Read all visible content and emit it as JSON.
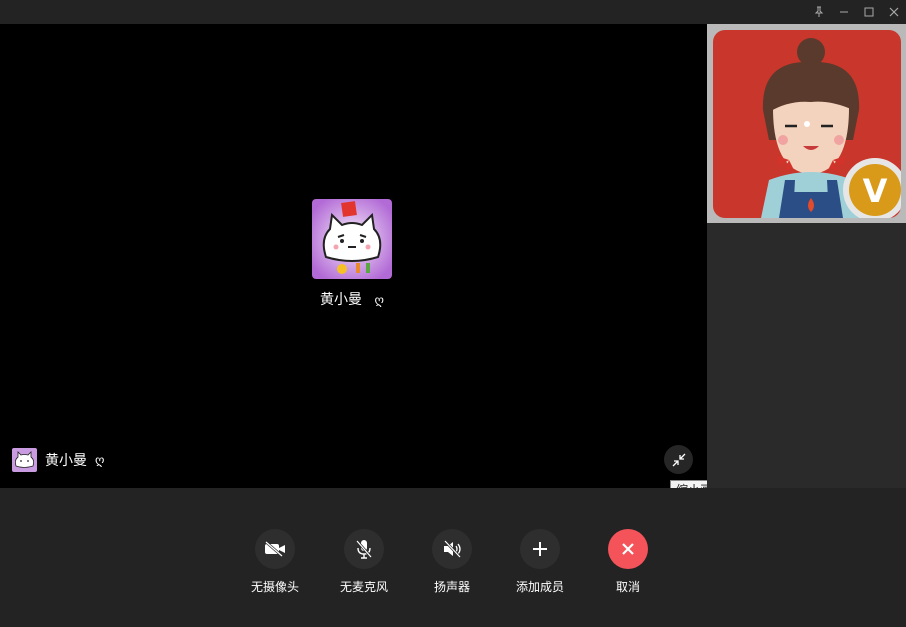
{
  "window": {
    "buttons": [
      "pin-icon",
      "minimize-icon",
      "maximize-icon",
      "close-icon"
    ]
  },
  "call": {
    "caller_name": "黄小曼",
    "corner_name": "黄小曼",
    "status_glyph": "ღ",
    "shrink_tooltip": "缩小画面"
  },
  "side": {
    "badge_letter": "V"
  },
  "controls": [
    {
      "id": "camera",
      "label": "无摄像头",
      "icon": "camera-off-icon"
    },
    {
      "id": "mic",
      "label": "无麦克风",
      "icon": "mic-off-icon"
    },
    {
      "id": "speaker",
      "label": "扬声器",
      "icon": "speaker-muted-icon"
    },
    {
      "id": "add",
      "label": "添加成员",
      "icon": "plus-icon"
    },
    {
      "id": "cancel",
      "label": "取消",
      "icon": "close-icon",
      "color": "#f4535a"
    }
  ]
}
